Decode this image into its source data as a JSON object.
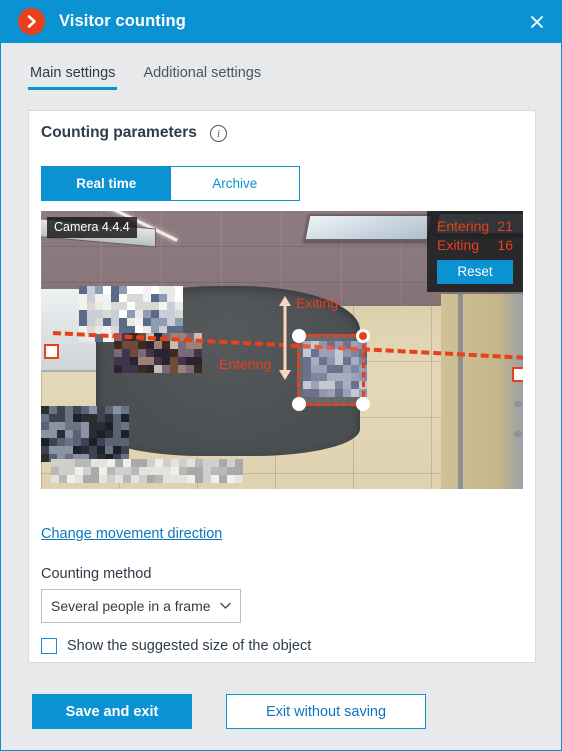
{
  "window": {
    "title": "Visitor counting",
    "logo_icon": "chevron-right-circle-icon",
    "close_icon": "close-icon",
    "accent_color": "#0a92d2",
    "brand_color": "#e8401a"
  },
  "tabs": [
    {
      "label": "Main settings",
      "active": true
    },
    {
      "label": "Additional settings",
      "active": false
    }
  ],
  "card": {
    "title": "Counting parameters",
    "info_icon": "info-icon",
    "mode_toggle": {
      "options": [
        {
          "label": "Real time",
          "active": true
        },
        {
          "label": "Archive",
          "active": false
        }
      ]
    }
  },
  "video": {
    "camera_label": "Camera 4.4.4",
    "counters": {
      "entering_label": "Entering",
      "entering_value": "21",
      "exiting_label": "Exiting",
      "exiting_value": "16",
      "reset_label": "Reset"
    },
    "direction_labels": {
      "exiting": "Exiting",
      "entering": "Entering"
    },
    "line_color": "#e8401a"
  },
  "form": {
    "change_direction_link": "Change movement direction",
    "counting_method_label": "Counting method",
    "counting_method_value": "Several people in a frame",
    "dropdown_icon": "chevron-down-icon",
    "show_size_label": "Show the suggested size of the object",
    "show_size_checked": false
  },
  "footer": {
    "save_label": "Save and exit",
    "cancel_label": "Exit without saving"
  }
}
